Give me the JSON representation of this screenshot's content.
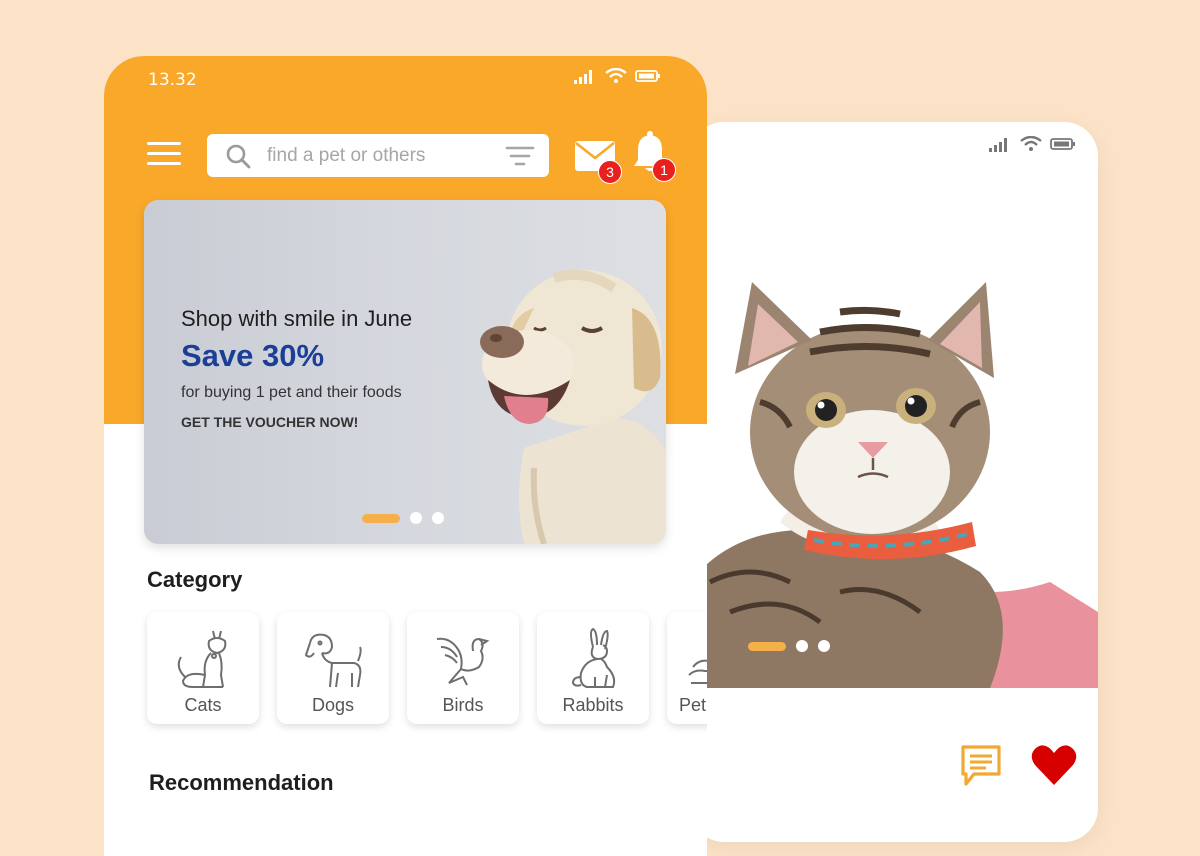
{
  "colors": {
    "page_bg": "#FCE3C7",
    "brand_orange": "#F9A82A",
    "save_blue": "#1B3F97",
    "badge_red": "#E8211F",
    "heart_red": "#D60000"
  },
  "front_phone": {
    "status": {
      "time": "13.32",
      "icons": [
        "signal-icon",
        "wifi-icon",
        "battery-icon"
      ]
    },
    "search": {
      "placeholder": "find a pet or others"
    },
    "notifications": {
      "mail_count": "3",
      "bell_count": "1"
    },
    "banner": {
      "headline": "Shop with smile in June",
      "save": "Save 30%",
      "subtext": "for buying 1 pet and their foods",
      "cta": "GET THE VOUCHER NOW!",
      "slide_count": 3,
      "active_slide": 1
    },
    "category_title": "Category",
    "categories": [
      {
        "label": "Cats",
        "icon": "cat-icon"
      },
      {
        "label": "Dogs",
        "icon": "dog-icon"
      },
      {
        "label": "Birds",
        "icon": "bird-icon"
      },
      {
        "label": "Rabbits",
        "icon": "rabbit-icon"
      },
      {
        "label": "Pet",
        "icon": "pet-icon"
      }
    ],
    "recommendation_title": "Recommendation"
  },
  "back_phone": {
    "status": {
      "icons": [
        "signal-icon",
        "wifi-icon",
        "battery-icon"
      ]
    },
    "gallery": {
      "slide_count": 3,
      "active_slide": 1
    },
    "actions": [
      "chat-icon",
      "heart-icon"
    ]
  }
}
